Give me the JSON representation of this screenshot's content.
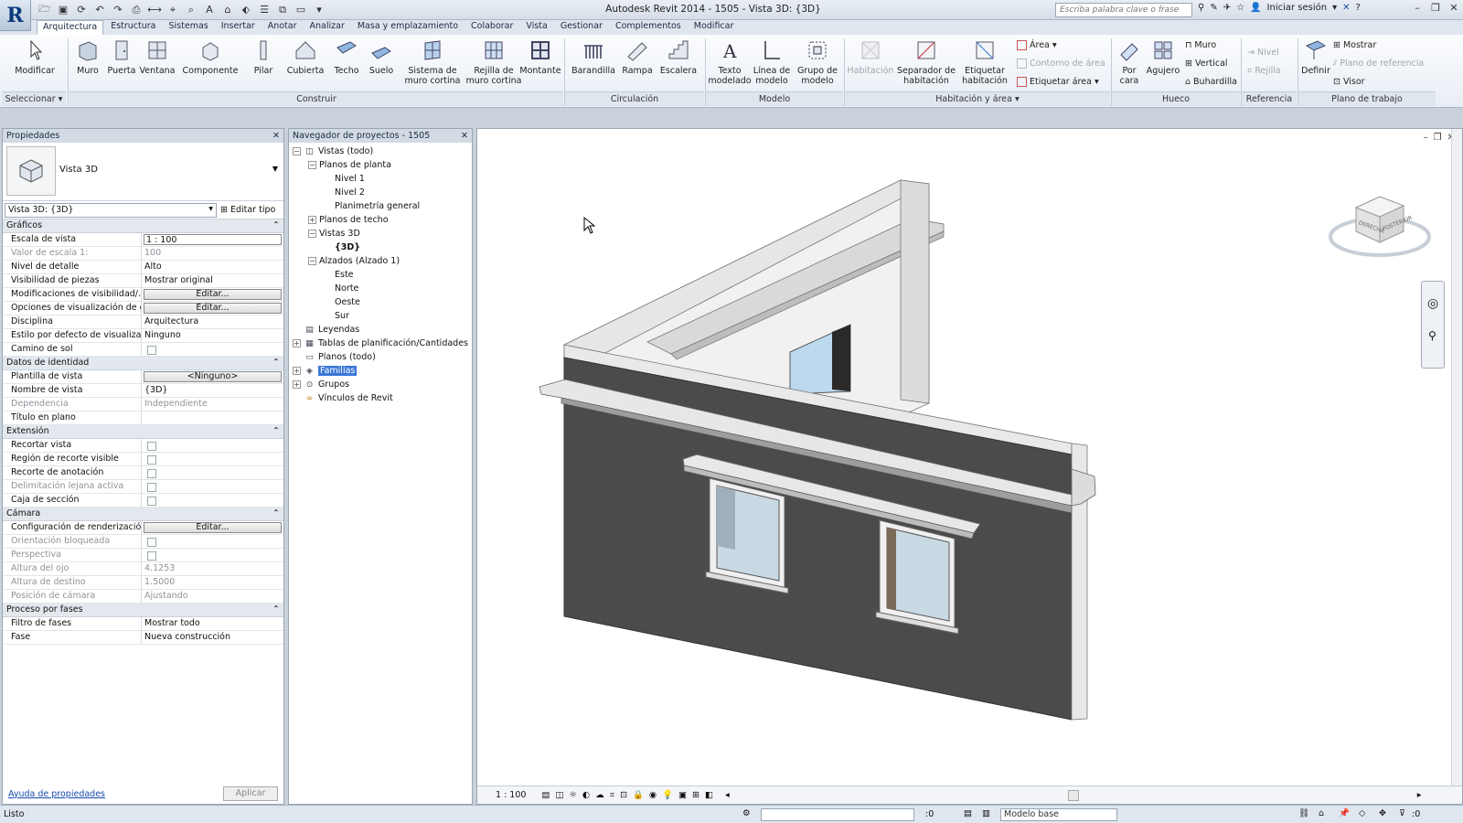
{
  "window": {
    "title": "Autodesk Revit 2014 -    1505 - Vista 3D: {3D}",
    "search_placeholder": "Escriba palabra clave o frase",
    "sign_in": "Iniciar sesión"
  },
  "ribbon_tabs": [
    "Arquitectura",
    "Estructura",
    "Sistemas",
    "Insertar",
    "Anotar",
    "Analizar",
    "Masa y emplazamiento",
    "Colaborar",
    "Vista",
    "Gestionar",
    "Complementos",
    "Modificar"
  ],
  "ribbon": {
    "select": {
      "modify": "Modificar",
      "panel": "Seleccionar ▾"
    },
    "build": {
      "wall": "Muro",
      "door": "Puerta",
      "window": "Ventana",
      "component": "Componente",
      "column": "Pilar",
      "roof": "Cubierta",
      "ceiling": "Techo",
      "floor": "Suelo",
      "curtain_system": "Sistema de muro cortina",
      "curtain_grid": "Rejilla de muro cortina",
      "mullion": "Montante",
      "panel": "Construir"
    },
    "circulation": {
      "railing": "Barandilla",
      "ramp": "Rampa",
      "stair": "Escalera",
      "panel": "Circulación"
    },
    "model": {
      "model_text": "Texto modelado",
      "model_line": "Línea de modelo",
      "model_group": "Grupo de modelo",
      "panel": "Modelo"
    },
    "room_area": {
      "room": "Habitación",
      "room_separator": "Separador de habitación",
      "tag_room": "Etiquetar habitación",
      "area": "Área ▾",
      "area_boundary": "Contorno de área",
      "tag_area": "Etiquetar área ▾",
      "panel": "Habitación y área ▾"
    },
    "opening": {
      "by_face": "Por cara",
      "shaft": "Agujero",
      "wall": "Muro",
      "vertical": "Vertical",
      "dormer": "Buhardilla",
      "panel": "Hueco"
    },
    "datum": {
      "level": "Nivel",
      "grid": "Rejilla",
      "panel": "Referencia"
    },
    "work_plane": {
      "set": "Definir",
      "show": "Mostrar",
      "ref_plane": "Plano de referencia",
      "viewer": "Visor",
      "panel": "Plano de trabajo"
    }
  },
  "properties": {
    "header": "Propiedades",
    "type_name": "Vista 3D",
    "instance_selector": "Vista 3D: {3D}",
    "edit_type": "Editar tipo",
    "groups": [
      {
        "name": "Gráficos",
        "rows": [
          {
            "k": "Escala de vista",
            "v": "1 : 100",
            "kind": "input"
          },
          {
            "k": "Valor de escala    1:",
            "v": "100",
            "kind": "text",
            "dis": true
          },
          {
            "k": "Nivel de detalle",
            "v": "Alto",
            "kind": "text"
          },
          {
            "k": "Visibilidad de piezas",
            "v": "Mostrar original",
            "kind": "text"
          },
          {
            "k": "Modificaciones de visibilidad/...",
            "v": "Editar...",
            "kind": "button"
          },
          {
            "k": "Opciones de visualización de g...",
            "v": "Editar...",
            "kind": "button"
          },
          {
            "k": "Disciplina",
            "v": "Arquitectura",
            "kind": "text"
          },
          {
            "k": "Estilo por defecto de visualizaci...",
            "v": "Ninguno",
            "kind": "text"
          },
          {
            "k": "Camino de sol",
            "v": "",
            "kind": "check"
          }
        ]
      },
      {
        "name": "Datos de identidad",
        "rows": [
          {
            "k": "Plantilla de vista",
            "v": "<Ninguno>",
            "kind": "button"
          },
          {
            "k": "Nombre de vista",
            "v": "{3D}",
            "kind": "text"
          },
          {
            "k": "Dependencia",
            "v": "Independiente",
            "kind": "text",
            "dis": true
          },
          {
            "k": "Título en plano",
            "v": "",
            "kind": "text"
          }
        ]
      },
      {
        "name": "Extensión",
        "rows": [
          {
            "k": "Recortar vista",
            "v": "",
            "kind": "check"
          },
          {
            "k": "Región de recorte visible",
            "v": "",
            "kind": "check"
          },
          {
            "k": "Recorte de anotación",
            "v": "",
            "kind": "check"
          },
          {
            "k": "Delimitación lejana activa",
            "v": "",
            "kind": "check",
            "dis": true
          },
          {
            "k": "Caja de sección",
            "v": "",
            "kind": "check"
          }
        ]
      },
      {
        "name": "Cámara",
        "rows": [
          {
            "k": "Configuración de renderización",
            "v": "Editar...",
            "kind": "button"
          },
          {
            "k": "Orientación bloqueada",
            "v": "",
            "kind": "check",
            "dis": true
          },
          {
            "k": "Perspectiva",
            "v": "",
            "kind": "check",
            "dis": true
          },
          {
            "k": "Altura del ojo",
            "v": "4.1253",
            "kind": "text",
            "dis": true
          },
          {
            "k": "Altura de destino",
            "v": "1.5000",
            "kind": "text",
            "dis": true
          },
          {
            "k": "Posición de cámara",
            "v": "Ajustando",
            "kind": "text",
            "dis": true
          }
        ]
      },
      {
        "name": "Proceso por fases",
        "rows": [
          {
            "k": "Filtro de fases",
            "v": "Mostrar todo",
            "kind": "text"
          },
          {
            "k": "Fase",
            "v": "Nueva construcción",
            "kind": "text"
          }
        ]
      }
    ],
    "help_link": "Ayuda de propiedades",
    "apply": "Aplicar"
  },
  "browser": {
    "header": "Navegador de proyectos - 1505",
    "nodes": [
      {
        "label": "Vistas (todo)",
        "depth": 0,
        "exp": "-",
        "icon": "views"
      },
      {
        "label": "Planos de planta",
        "depth": 1,
        "exp": "-"
      },
      {
        "label": "Nivel 1",
        "depth": 2
      },
      {
        "label": "Nivel 2",
        "depth": 2
      },
      {
        "label": "Planimetría general",
        "depth": 2
      },
      {
        "label": "Planos de techo",
        "depth": 1,
        "exp": "+"
      },
      {
        "label": "Vistas 3D",
        "depth": 1,
        "exp": "-"
      },
      {
        "label": "{3D}",
        "depth": 2,
        "bold": true
      },
      {
        "label": "Alzados (Alzado 1)",
        "depth": 1,
        "exp": "-"
      },
      {
        "label": "Este",
        "depth": 2
      },
      {
        "label": "Norte",
        "depth": 2
      },
      {
        "label": "Oeste",
        "depth": 2
      },
      {
        "label": "Sur",
        "depth": 2
      },
      {
        "label": "Leyendas",
        "depth": 0,
        "icon": "legend"
      },
      {
        "label": "Tablas de planificación/Cantidades",
        "depth": 0,
        "exp": "+",
        "icon": "schedule"
      },
      {
        "label": "Planos (todo)",
        "depth": 0,
        "icon": "sheet"
      },
      {
        "label": "Familias",
        "depth": 0,
        "exp": "+",
        "icon": "family",
        "selected": true
      },
      {
        "label": "Grupos",
        "depth": 0,
        "exp": "+",
        "icon": "group"
      },
      {
        "label": "Vínculos de Revit",
        "depth": 0,
        "icon": "link"
      }
    ]
  },
  "viewport": {
    "scale": "1 : 100",
    "viewcube_faces": [
      "DERECHA",
      "POSTERIOR"
    ]
  },
  "status": {
    "text": "Listo",
    "selection_count": ":0",
    "workset": "Modelo base",
    "filter_count": ":0"
  }
}
